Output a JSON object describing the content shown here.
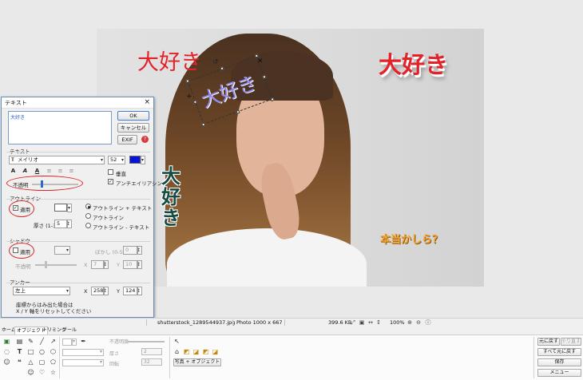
{
  "canvas": {
    "overlays": {
      "red_left": "大好き",
      "red_right": "大好き",
      "vertical_chars": [
        "大",
        "好",
        "き"
      ],
      "orange": "本当かしら？",
      "rotated": "大好き"
    }
  },
  "dialog": {
    "title": "テキスト",
    "close": "×",
    "textarea_value": "大好き",
    "ok": "OK",
    "cancel": "キャンセル",
    "exif": "EXIF",
    "help": "?",
    "text_section": "テキスト",
    "font_name": "メイリオ",
    "font_size": "52",
    "text_color": "#0a12d8",
    "format_buttons": [
      "A",
      "A",
      "A",
      "≡",
      "≡",
      "≡"
    ],
    "vertical_label": "垂直",
    "antialias_label": "アンチエイリアシン",
    "opacity_label": "不透明",
    "opacity_fraction": 0.2,
    "outline_section": "アウトライン",
    "outline_apply": "適用",
    "outline_width_label": "厚さ (1-36)",
    "outline_width_value": "5",
    "outline_color": "#ffffff",
    "outline_options": [
      "アウトライン + テキスト",
      "アウトライン",
      "アウトライン - テキスト"
    ],
    "shadow_section": "シャドウ",
    "shadow_apply": "適用",
    "shadow_blur_label": "ぼかし (0-5)",
    "shadow_blur_value": "0",
    "shadow_opacity_label": "不透明",
    "shadow_x_label": "X",
    "shadow_x_value": "7",
    "shadow_y_label": "Y",
    "shadow_y_value": "10",
    "anchor_section": "アンカー",
    "anchor_value": "左上",
    "anchor_x_label": "X",
    "anchor_x_value": "258",
    "anchor_y_label": "Y",
    "anchor_y_value": "124",
    "note_line1": "座標からはみ出た場合は",
    "note_line2": "X / Y 軸をリセットしてください"
  },
  "statusbar": {
    "filename": "shutterstock_1289544937.jpg",
    "dimensions": "Photo 1000 x 667",
    "filesize": "399.6 KB",
    "zoom": "100%"
  },
  "bottom": {
    "tabs": [
      "ホーム",
      "オブジェクト",
      "トリミング",
      "ツール"
    ],
    "opacity_label": "不透明度",
    "thickness_label": "厚さ",
    "thickness_value": "2",
    "rotation_label": "回転",
    "rotation_value": "32",
    "photo_object_button": "写真 + オブジェクト",
    "undo": "元に戻す",
    "redo": "やり直す",
    "undo_all": "すべて元に戻す",
    "save": "保存",
    "menu": "メニュー"
  }
}
